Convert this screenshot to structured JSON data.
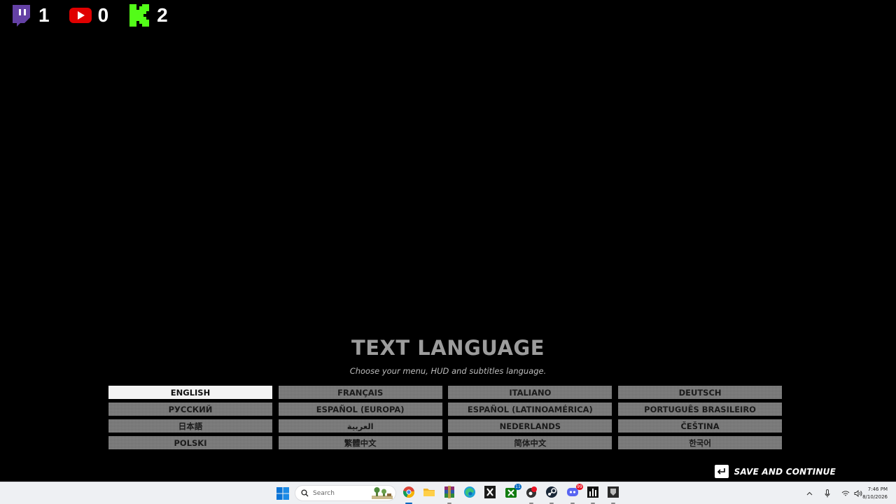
{
  "overlay": {
    "items": [
      {
        "platform": "twitch",
        "icon": "twitch-icon",
        "count": "1",
        "color": "#6441a5"
      },
      {
        "platform": "youtube",
        "icon": "youtube-icon",
        "count": "0",
        "color": "#e00000"
      },
      {
        "platform": "kick",
        "icon": "kick-icon",
        "count": "2",
        "color": "#53fc18"
      }
    ]
  },
  "menu": {
    "title": "TEXT LANGUAGE",
    "subtitle": "Choose your menu, HUD and subtitles language.",
    "selected": "ENGLISH",
    "languages": [
      "ENGLISH",
      "FRANÇAIS",
      "ITALIANO",
      "DEUTSCH",
      "РУССКИЙ",
      "ESPAÑOL (EUROPA)",
      "ESPAÑOL (LATINOAMÉRICA)",
      "PORTUGUÊS BRASILEIRO",
      "日本語",
      "العربية",
      "NEDERLANDS",
      "ČEŠTINA",
      "POLSKI",
      "繁體中文",
      "简体中文",
      "한국어"
    ],
    "save_label": "SAVE AND CONTINUE",
    "save_icon": "enter-key-icon"
  },
  "taskbar": {
    "search_placeholder": "Search",
    "apps": [
      {
        "name": "chrome",
        "icon": "chrome-icon"
      },
      {
        "name": "file-explorer",
        "icon": "folder-icon"
      },
      {
        "name": "winrar",
        "icon": "archive-icon"
      },
      {
        "name": "edge",
        "icon": "edge-icon"
      },
      {
        "name": "epic-games",
        "icon": "epic-games-icon"
      },
      {
        "name": "xbox",
        "icon": "xbox-icon",
        "badge": "11"
      },
      {
        "name": "app-red",
        "icon": "record-icon"
      },
      {
        "name": "steam",
        "icon": "steam-icon"
      },
      {
        "name": "discord",
        "icon": "discord-icon",
        "badge": "99"
      },
      {
        "name": "audio-app",
        "icon": "equalizer-icon"
      },
      {
        "name": "game-app",
        "icon": "game-icon"
      }
    ],
    "clock": {
      "time": "7:46 PM",
      "date": "8/10/2026"
    }
  }
}
